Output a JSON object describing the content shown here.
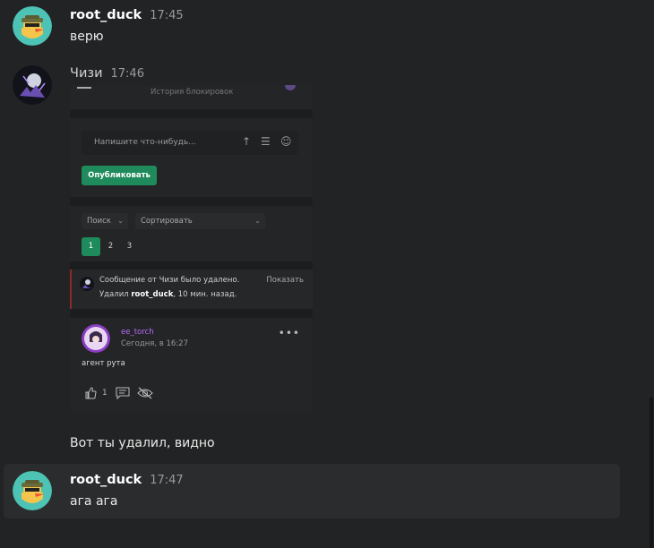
{
  "messages": [
    {
      "author": "root_duck",
      "time": "17:45",
      "text": "верю"
    },
    {
      "author": "Чизи",
      "time": "17:46",
      "text": "Вот ты удалил, видно"
    },
    {
      "author": "root_duck",
      "time": "17:47",
      "text": "ага ага"
    }
  ],
  "attachment": {
    "top_text": "История блокировок",
    "compose_placeholder": "Напишите что-нибудь...",
    "publish_label": "Опубликовать",
    "search_label": "Поиск",
    "sort_label": "Сортировать",
    "pages": [
      "1",
      "2",
      "3"
    ],
    "active_page": "1",
    "deleted_text": "Сообщение от Чизи было удалено.",
    "deleted_by_prefix": "Удалил ",
    "deleted_by_user": "root_duck",
    "deleted_by_suffix": ", 10 мин. назад.",
    "show_label": "Показать",
    "post_author": "ee_torch",
    "post_time": "Сегодня, в 16:27",
    "post_text": "агент рута",
    "like_count": "1"
  },
  "colors": {
    "background": "#222324",
    "accent_green": "#1f8a5b",
    "post_author": "#b66bff",
    "deleted_border": "#8b2a2a"
  }
}
